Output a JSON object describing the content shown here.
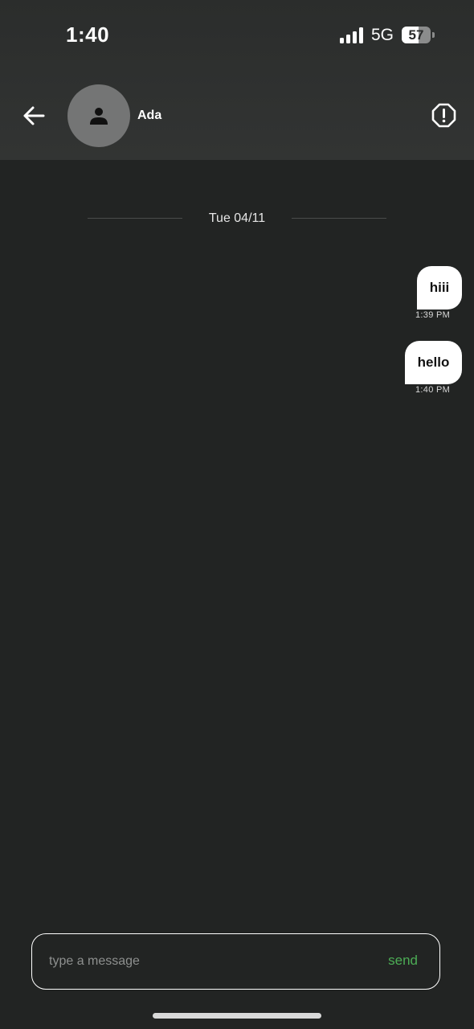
{
  "status_bar": {
    "time": "1:40",
    "network": "5G",
    "signal_bars": 4,
    "battery_percent": 57,
    "battery_label": "57"
  },
  "header": {
    "back_icon": "arrow-left-icon",
    "avatar_icon": "person-icon",
    "contact_name": "Ada",
    "report_icon": "alert-circle-icon"
  },
  "conversation": {
    "date_separator": "Tue 04/11",
    "messages": [
      {
        "text": "hiii",
        "time": "1:39 PM",
        "sender": "me"
      },
      {
        "text": "hello",
        "time": "1:40 PM",
        "sender": "me"
      }
    ]
  },
  "composer": {
    "placeholder": "type a message",
    "value": "",
    "send_label": "send"
  },
  "colors": {
    "background": "#222423",
    "header": "#303231",
    "bubble": "#ffffff",
    "send_accent": "#4cad55",
    "avatar": "#747575"
  }
}
